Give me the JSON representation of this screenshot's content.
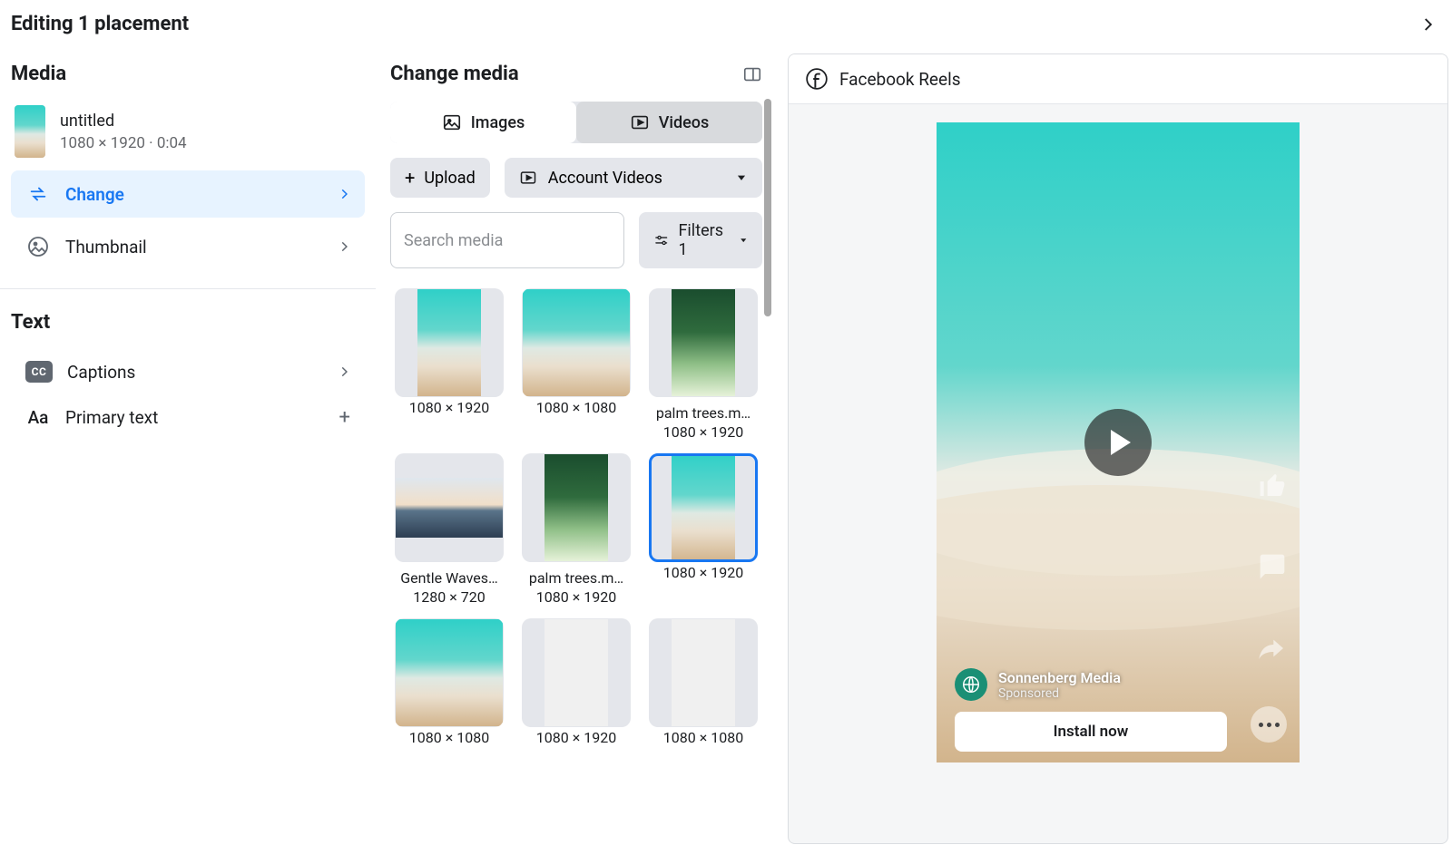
{
  "header": {
    "title": "Editing 1 placement"
  },
  "sidebar": {
    "media_title": "Media",
    "media_item": {
      "name": "untitled",
      "meta": "1080 × 1920 · 0:04"
    },
    "change_label": "Change",
    "thumbnail_label": "Thumbnail",
    "text_title": "Text",
    "captions_label": "Captions",
    "primary_text_label": "Primary text",
    "cc_badge": "CC",
    "aa_badge": "Aa"
  },
  "media_panel": {
    "title": "Change media",
    "tab_images": "Images",
    "tab_videos": "Videos",
    "upload": "Upload",
    "account_videos": "Account Videos",
    "search_placeholder": "Search media",
    "filters": "Filters 1",
    "items": [
      {
        "title": "",
        "dim": "1080 × 1920",
        "shape": "port",
        "type": "beach",
        "selected": false
      },
      {
        "title": "",
        "dim": "1080 × 1080",
        "shape": "square",
        "type": "beach",
        "selected": false
      },
      {
        "title": "palm trees.m…",
        "dim": "1080 × 1920",
        "shape": "port",
        "type": "palm",
        "selected": false
      },
      {
        "title": "Gentle Waves…",
        "dim": "1280 × 720",
        "shape": "land",
        "type": "horizon",
        "selected": false
      },
      {
        "title": "palm trees.m…",
        "dim": "1080 × 1920",
        "shape": "port",
        "type": "palm",
        "selected": false
      },
      {
        "title": "",
        "dim": "1080 × 1920",
        "shape": "port",
        "type": "beach",
        "selected": true
      },
      {
        "title": "",
        "dim": "1080 × 1080",
        "shape": "square",
        "type": "beach",
        "selected": false
      },
      {
        "title": "",
        "dim": "1080 × 1920",
        "shape": "port",
        "type": "blank",
        "selected": false
      },
      {
        "title": "",
        "dim": "1080 × 1080",
        "shape": "port",
        "type": "blank",
        "selected": false
      }
    ]
  },
  "preview": {
    "placement": "Facebook Reels",
    "advertiser": "Sonnenberg Media",
    "sponsored": "Sponsored",
    "cta": "Install now"
  }
}
